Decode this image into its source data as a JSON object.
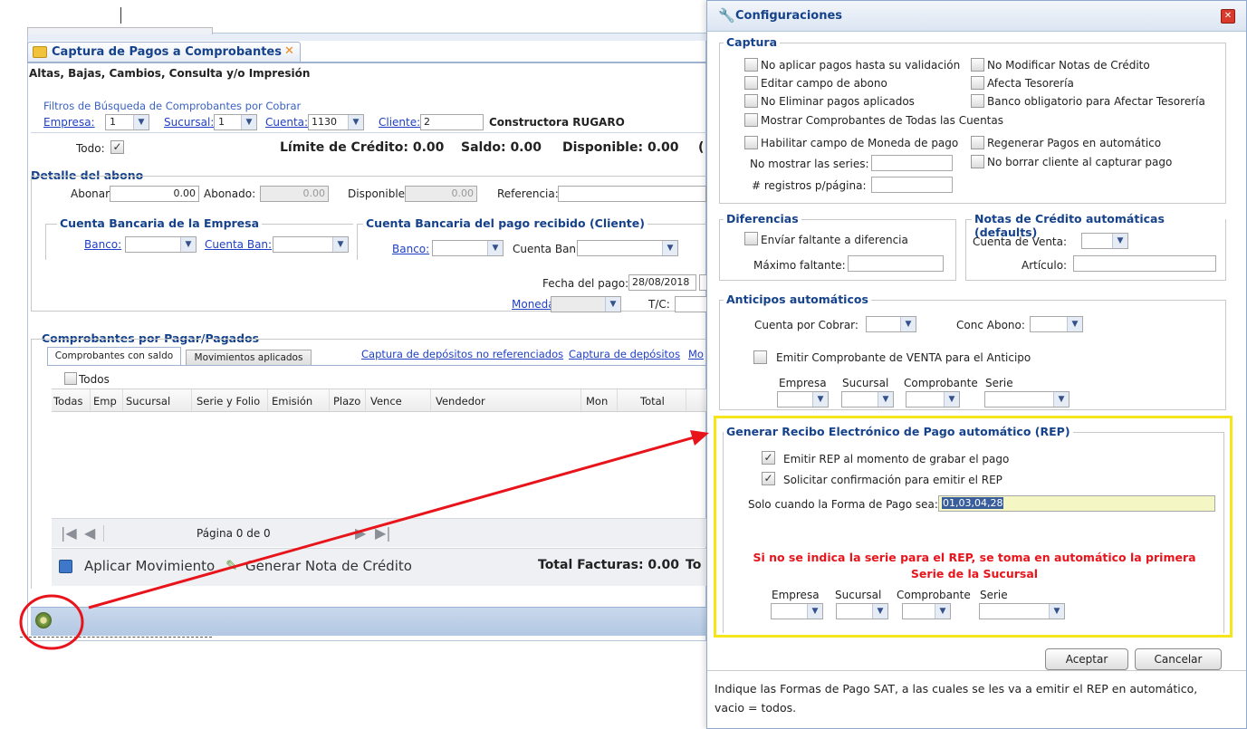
{
  "left": {
    "tab_title": "Captura de Pagos a Comprobantes",
    "subtitle": "Altas, Bajas, Cambios, Consulta y/o Impresión",
    "filters": {
      "legend": "Filtros de Búsqueda de Comprobantes por Cobrar",
      "empresa_label": "Empresa:",
      "empresa": "1",
      "sucursal_label": "Sucursal:",
      "sucursal": "1",
      "cuenta_label": "Cuenta:",
      "cuenta": "1130",
      "cliente_label": "Cliente:",
      "cliente": "2",
      "cliente_name": "Constructora RUGARO"
    },
    "summary": {
      "todo_label": "Todo:",
      "limite": "Límite de Crédito: 0.00",
      "saldo": "Saldo: 0.00",
      "disponible": "Disponible: 0.00",
      "trailing": "("
    },
    "abono": {
      "legend": "Detalle del abono",
      "abonar_label": "Abonar:",
      "abonar": "0.00",
      "abonado_label": "Abonado:",
      "abonado": "0.00",
      "disponible_label": "Disponible",
      "disponible": "0.00",
      "referencia_label": "Referencia:",
      "bank1": {
        "legend": "Cuenta Bancaria de la Empresa",
        "banco_label": "Banco:",
        "cuenta_label": "Cuenta Ban:"
      },
      "bank2": {
        "legend": "Cuenta Bancaria del pago recibido (Cliente)",
        "banco_label": "Banco:",
        "cuenta_label": "Cuenta Ban:"
      },
      "fecha_label": "Fecha del pago:",
      "fecha": "28/08/2018",
      "moneda_label": "Moneda:",
      "tc_label": "T/C:"
    },
    "comprobantes": {
      "legend": "Comprobantes por Pagar/Pagados",
      "tab1": "Comprobantes con saldo",
      "tab2": "Movimientos aplicados",
      "link1": "Captura de depósitos no referenciados",
      "link2": "Captura de depósitos",
      "link3": "Mo",
      "todos": "Todos",
      "columns": [
        "Todas",
        "Emp",
        "Sucursal",
        "Serie y Folio",
        "Emisión",
        "Plazo",
        "Vence",
        "Vendedor",
        "Mon",
        "Total"
      ],
      "pager": "Página 0 de 0",
      "aplicar": "Aplicar Movimiento",
      "generar": "Generar Nota de Crédito",
      "total_facturas": "Total Facturas: 0.00",
      "total_trailing": "To"
    }
  },
  "dialog": {
    "title": "Configuraciones",
    "captura": {
      "legend": "Captura",
      "options_left": [
        "No aplicar pagos hasta su validación",
        "Editar campo de abono",
        "No Eliminar pagos aplicados",
        "Mostrar Comprobantes de Todas las Cuentas",
        "Habilitar campo de Moneda de pago"
      ],
      "options_right": [
        "No Modificar Notas de Crédito",
        "Afecta Tesorería",
        "Banco obligatorio para Afectar Tesorería",
        "Regenerar Pagos en automático",
        "No borrar cliente al capturar pago"
      ],
      "series_label": "No mostrar las series:",
      "registros_label": "# registros p/página:"
    },
    "diferencias": {
      "legend": "Diferencias",
      "enviar": "Envíar faltante a diferencia",
      "maximo": "Máximo faltante:"
    },
    "notas": {
      "legend": "Notas de Crédito automáticas (defaults)",
      "cuenta_venta": "Cuenta de Venta:",
      "articulo": "Artículo:"
    },
    "anticipos": {
      "legend": "Anticipos automáticos",
      "cxc": "Cuenta por Cobrar:",
      "conc": "Conc Abono:",
      "emitir": "Emitir Comprobante de VENTA para el Anticipo",
      "cols": [
        "Empresa",
        "Sucursal",
        "Comprobante",
        "Serie"
      ]
    },
    "rep": {
      "legend": "Generar Recibo Electrónico de Pago automático (REP)",
      "emitir": "Emitir REP al momento de grabar el pago",
      "solicitar": "Solicitar confirmación para emitir el REP",
      "forma_label": "Solo cuando la Forma de Pago sea:",
      "forma_value": "01,03,04,28",
      "warning_line1": "Si no se indica la serie para el REP, se toma en automático la primera",
      "warning_line2": "Serie de la Sucursal",
      "cols": [
        "Empresa",
        "Sucursal",
        "Comprobante",
        "Serie"
      ]
    },
    "aceptar": "Aceptar",
    "cancelar": "Cancelar",
    "help_line1": "Indique las Formas de Pago SAT, a las cuales se les va a emitir el REP en automático,",
    "help_line2": "vacio = todos."
  },
  "colors": {
    "highlight": "#f5e61b",
    "annotation": "#e8141b",
    "warning": "#e8141b",
    "legend": "#15428b"
  }
}
